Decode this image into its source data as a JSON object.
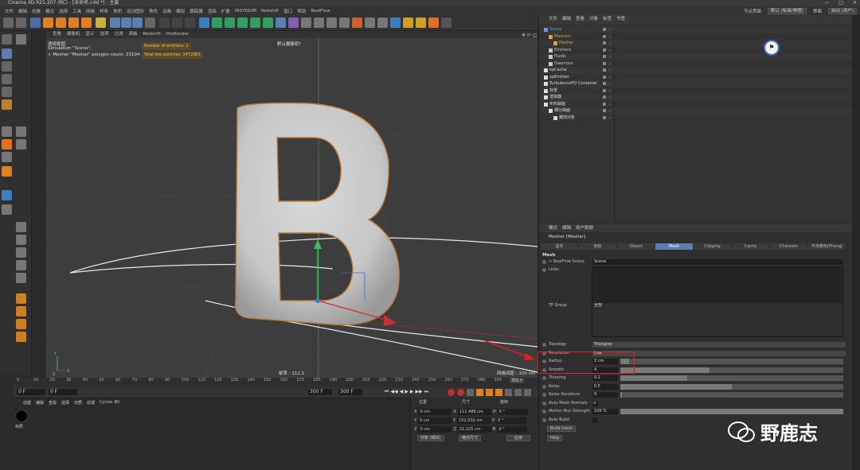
{
  "window": {
    "title": "Cinema 4D R21.207 (RC) - [未命名.c4d *] - 主要"
  },
  "menubar": {
    "items": [
      "文件",
      "编辑",
      "创建",
      "模式",
      "选择",
      "工具",
      "网格",
      "样条",
      "体积",
      "运动图形",
      "角色",
      "动画",
      "模拟",
      "跟踪器",
      "渲染",
      "扩展",
      "INSYDIUM",
      "Redshift",
      "窗口",
      "帮助",
      "RealFlow"
    ],
    "layout_label": "节点界面",
    "layout_value": "默认 (标准/物理)",
    "interface_label": "界面",
    "interface_value": "启动 (用户)"
  },
  "viewport": {
    "menu": [
      "查看",
      "摄像机",
      "显示",
      "选项",
      "过滤",
      "面板",
      "Redshift",
      "ProRender"
    ],
    "view_label": "透视视图",
    "camera_label": "默认摄像机*",
    "sim_line1": "Simulation \"Scene\":",
    "sim_line2": "> Mesher \"Mesher\" polygon count: 23104",
    "emitters": "Number of emitters: 1",
    "particles": "Total live particles: 3472381",
    "grid_info": "网格间距 : 100 cm",
    "fps_info": "帧率 : 111.1"
  },
  "timeline": {
    "ticks": [
      "0",
      "10",
      "20",
      "30",
      "40",
      "50",
      "60",
      "70",
      "80",
      "90",
      "100",
      "110",
      "120",
      "130",
      "140",
      "150",
      "160",
      "170",
      "180",
      "190",
      "200",
      "210",
      "220",
      "230",
      "240",
      "250",
      "260",
      "270",
      "280",
      "290",
      "300"
    ],
    "end_frame": "300 F",
    "current": "0 F",
    "start": "0 F",
    "range_end": "300 F",
    "range_end2": "300 F"
  },
  "material": {
    "menu": [
      "创建",
      "编辑",
      "查看",
      "选择",
      "材质",
      "纹理",
      "Cycles 4D"
    ],
    "swatch_label": "材质"
  },
  "coords": {
    "headers": [
      "位置",
      "尺寸",
      "旋转"
    ],
    "rows": [
      {
        "axis": "X",
        "pos": "0 cm",
        "size": "111.488 cm",
        "rot_axis": "H",
        "rot": "0 °"
      },
      {
        "axis": "Y",
        "pos": "0 cm",
        "size": "152.032 cm",
        "rot_axis": "P",
        "rot": "0 °"
      },
      {
        "axis": "Z",
        "pos": "0 cm",
        "size": "22.225 cm",
        "rot_axis": "B",
        "rot": "0 °"
      }
    ],
    "mode1": "对象 (相对)",
    "mode2": "绝对尺寸",
    "apply": "应用"
  },
  "object_manager": {
    "menu": [
      "文件",
      "编辑",
      "查看",
      "对象",
      "标签",
      "书签"
    ],
    "rows": [
      {
        "name": "Scene",
        "indent": 0,
        "color": "#5aa0e0"
      },
      {
        "name": "Meshers",
        "indent": 1,
        "color": "#e0a040"
      },
      {
        "name": "Mesher",
        "indent": 2,
        "color": "#e0a040"
      },
      {
        "name": "Emitters",
        "indent": 1,
        "color": "#c8c8c8"
      },
      {
        "name": "Fluids",
        "indent": 1,
        "color": "#c8c8c8"
      },
      {
        "name": "Daemons",
        "indent": 1,
        "color": "#c8c8c8"
      },
      {
        "name": "xpCache",
        "indent": 0,
        "color": "#dddddd"
      },
      {
        "name": "xpEmitter",
        "indent": 0,
        "color": "#dddddd"
      },
      {
        "name": "TurbulenceFD Container",
        "indent": 0,
        "color": "#dddddd"
      },
      {
        "name": "背景",
        "indent": 0,
        "color": "#dddddd"
      },
      {
        "name": "渲染器",
        "indent": 0,
        "color": "#dddddd"
      },
      {
        "name": "布料曲面",
        "indent": 0,
        "color": "#dddddd"
      },
      {
        "name": "细分曲面",
        "indent": 1,
        "color": "#dddddd"
      },
      {
        "name": "雕刻对象",
        "indent": 2,
        "color": "#dddddd"
      }
    ]
  },
  "attributes": {
    "menu": [
      "模式",
      "编辑",
      "用户数据"
    ],
    "object_title": "Mesher [Mesher]",
    "tabs": [
      "基本",
      "坐标",
      "Object",
      "Mesh",
      "Clipping",
      "Cache",
      "Channels",
      "平滑着色(Phong)"
    ],
    "active_tab": "Mesh",
    "section": "Mesh",
    "realflow_scene_label": "> RealFlow Scene",
    "realflow_scene_value": "Scene",
    "links_label": "Links",
    "tp_group_label": "TP Group",
    "tp_group_value": "全部",
    "params": [
      {
        "label": "Topology",
        "value": "Triangles",
        "kind": "dropdown"
      },
      {
        "label": "Resolution",
        "value": "Low",
        "kind": "dropdown"
      },
      {
        "label": "Radius",
        "value": "3 cm",
        "kind": "slider",
        "fill": 0.04
      },
      {
        "label": "Smooth",
        "value": "4",
        "kind": "slider",
        "fill": 0.4
      },
      {
        "label": "Thinning",
        "value": "0.2",
        "kind": "slider",
        "fill": 0.3
      },
      {
        "label": "Relax",
        "value": "0.5",
        "kind": "slider",
        "fill": 0.5
      },
      {
        "label": "Relax Iterations",
        "value": "0",
        "kind": "slider",
        "fill": 0
      },
      {
        "label": "Auto Mesh Normals",
        "value": "✔",
        "kind": "check"
      },
      {
        "label": "Motion Blur Strength",
        "value": "100 %",
        "kind": "slider",
        "fill": 1.0
      },
      {
        "label": "Auto Build",
        "value": "",
        "kind": "check"
      }
    ],
    "build_button": "Build mesh",
    "help_button": "Help"
  },
  "watermark": {
    "text": "野鹿志"
  }
}
